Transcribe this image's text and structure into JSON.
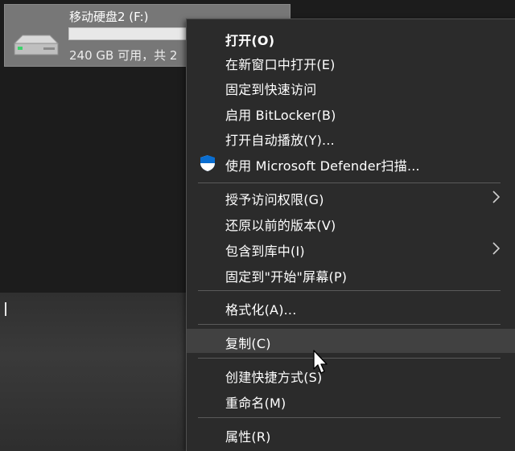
{
  "drive": {
    "name": "移动硬盘2 (F:)",
    "space_text": "240 GB 可用，共 2",
    "used_fraction": 0.0,
    "icon": "drive-icon"
  },
  "context_menu": {
    "items": [
      {
        "label": "打开(O)",
        "bold": true
      },
      {
        "label": "在新窗口中打开(E)"
      },
      {
        "label": "固定到快速访问"
      },
      {
        "label": "启用 BitLocker(B)"
      },
      {
        "label": "打开自动播放(Y)..."
      },
      {
        "label": "使用 Microsoft Defender扫描...",
        "icon": "defender-shield-icon"
      },
      {
        "label": "授予访问权限(G)",
        "submenu": true
      },
      {
        "label": "还原以前的版本(V)"
      },
      {
        "label": "包含到库中(I)",
        "submenu": true
      },
      {
        "label": "固定到\"开始\"屏幕(P)"
      },
      {
        "label": "格式化(A)..."
      },
      {
        "label": "复制(C)",
        "hovered": true
      },
      {
        "label": "创建快捷方式(S)"
      },
      {
        "label": "重命名(M)"
      },
      {
        "label": "属性(R)"
      }
    ]
  },
  "colors": {
    "menu_background": "#2b2b2b",
    "menu_hover": "#414141",
    "selection": "#777777",
    "shield_blue": "#0a6ed1"
  }
}
